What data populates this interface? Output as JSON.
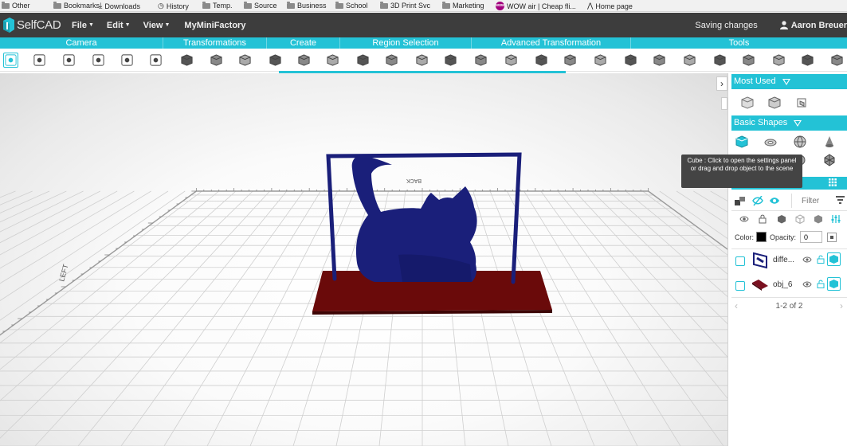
{
  "bookmarks": [
    {
      "label": "Other",
      "icon": "folder-icon"
    },
    {
      "label": "Bookmarks",
      "icon": "folder-icon"
    },
    {
      "label": "Downloads",
      "icon": "download-icon"
    },
    {
      "label": "History",
      "icon": "history-icon"
    },
    {
      "label": "Temp.",
      "icon": "folder-icon"
    },
    {
      "label": "Source",
      "icon": "folder-icon"
    },
    {
      "label": "Business",
      "icon": "folder-icon"
    },
    {
      "label": "School",
      "icon": "folder-icon"
    },
    {
      "label": "3D Print Svc",
      "icon": "folder-icon"
    },
    {
      "label": "Marketing",
      "icon": "folder-icon"
    },
    {
      "label": "WOW air | Cheap fli...",
      "icon": "wow-icon"
    },
    {
      "label": "Home page",
      "icon": "home-icon"
    }
  ],
  "header": {
    "app_name": "SelfCAD",
    "menus": [
      "File",
      "Edit",
      "View"
    ],
    "link": "MyMiniFactory",
    "status": "Saving changes",
    "user": "Aaron Breuer"
  },
  "categories": [
    "Camera",
    "Transformations",
    "Create",
    "Region Selection",
    "Advanced Transformation",
    "Tools"
  ],
  "colors": {
    "accent": "#23c2d6",
    "header_bg": "#3d3d3d",
    "object_blue": "#1a1f7a",
    "base_red": "#6a0a0a"
  },
  "viewport": {
    "axis_label_front": "BACK",
    "axis_label_left": "LEFT"
  },
  "sidebar": {
    "most_used_title": "Most Used",
    "basic_shapes_title": "Basic Shapes",
    "tooltip": "Cube : Click to open the settings panel or drag and drop object to the scene",
    "filter_placeholder": "Filter",
    "color_label": "Color:",
    "opacity_label": "Opacity:",
    "opacity_value": "0",
    "objects": [
      {
        "name": "diffe...",
        "thumb": "difference-thumb"
      },
      {
        "name": "obj_6",
        "thumb": "plate-thumb"
      }
    ],
    "pager": "1-2 of 2"
  }
}
